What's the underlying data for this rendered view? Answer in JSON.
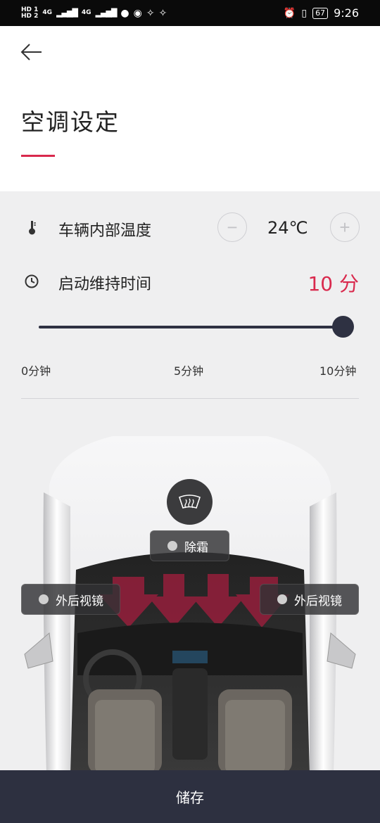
{
  "status_bar": {
    "left_items": [
      "HD 1",
      "HD 2",
      "4G",
      "4G"
    ],
    "right_battery": "67",
    "time": "9:26"
  },
  "header": {
    "back_icon": "arrow-left-icon",
    "title": "空调设定"
  },
  "settings": {
    "temperature": {
      "icon": "thermometer-icon",
      "label": "车辆内部温度",
      "value": "24℃",
      "decrease_symbol": "−",
      "increase_symbol": "+"
    },
    "duration": {
      "icon": "clock-icon",
      "label": "启动维持时间",
      "value": "10 分"
    },
    "slider": {
      "min_label": "0分钟",
      "mid_label": "5分钟",
      "max_label": "10分钟",
      "value_fraction": 1.0
    }
  },
  "car": {
    "defrost_icon": "windshield-defrost-icon",
    "defrost_label": "除霜",
    "mirror_left_label": "外后视镜",
    "mirror_right_label": "外后视镜"
  },
  "footer": {
    "save_label": "储存"
  },
  "colors": {
    "accent": "#d9294d",
    "dark": "#2e3142",
    "footer_bg": "#2d3040"
  }
}
